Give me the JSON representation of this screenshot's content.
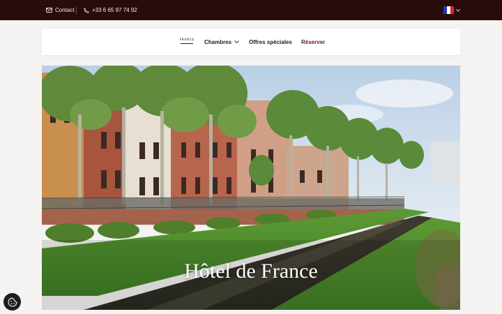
{
  "topbar": {
    "contact_label": "Contact",
    "phone_label": "+33 6 65 97 74 92",
    "language": "fr",
    "flag_colors": [
      "#1b3fa8",
      "#ffffff",
      "#e1242b"
    ]
  },
  "navbar": {
    "logo_text": "FRANCE",
    "items": [
      {
        "label": "Chambres",
        "icon": "chevron-down-icon"
      },
      {
        "label": "Offres spéciales"
      },
      {
        "label": "Réserver"
      }
    ]
  },
  "hero": {
    "title": "Hôtel de France"
  },
  "colors": {
    "topbar_bg": "#2a0b0b",
    "accent": "#6a1a1a",
    "page_bg": "#f4f3f1"
  },
  "icons": {
    "contact": "mail-icon",
    "phone": "phone-icon",
    "cookie": "cookie-settings-icon"
  }
}
